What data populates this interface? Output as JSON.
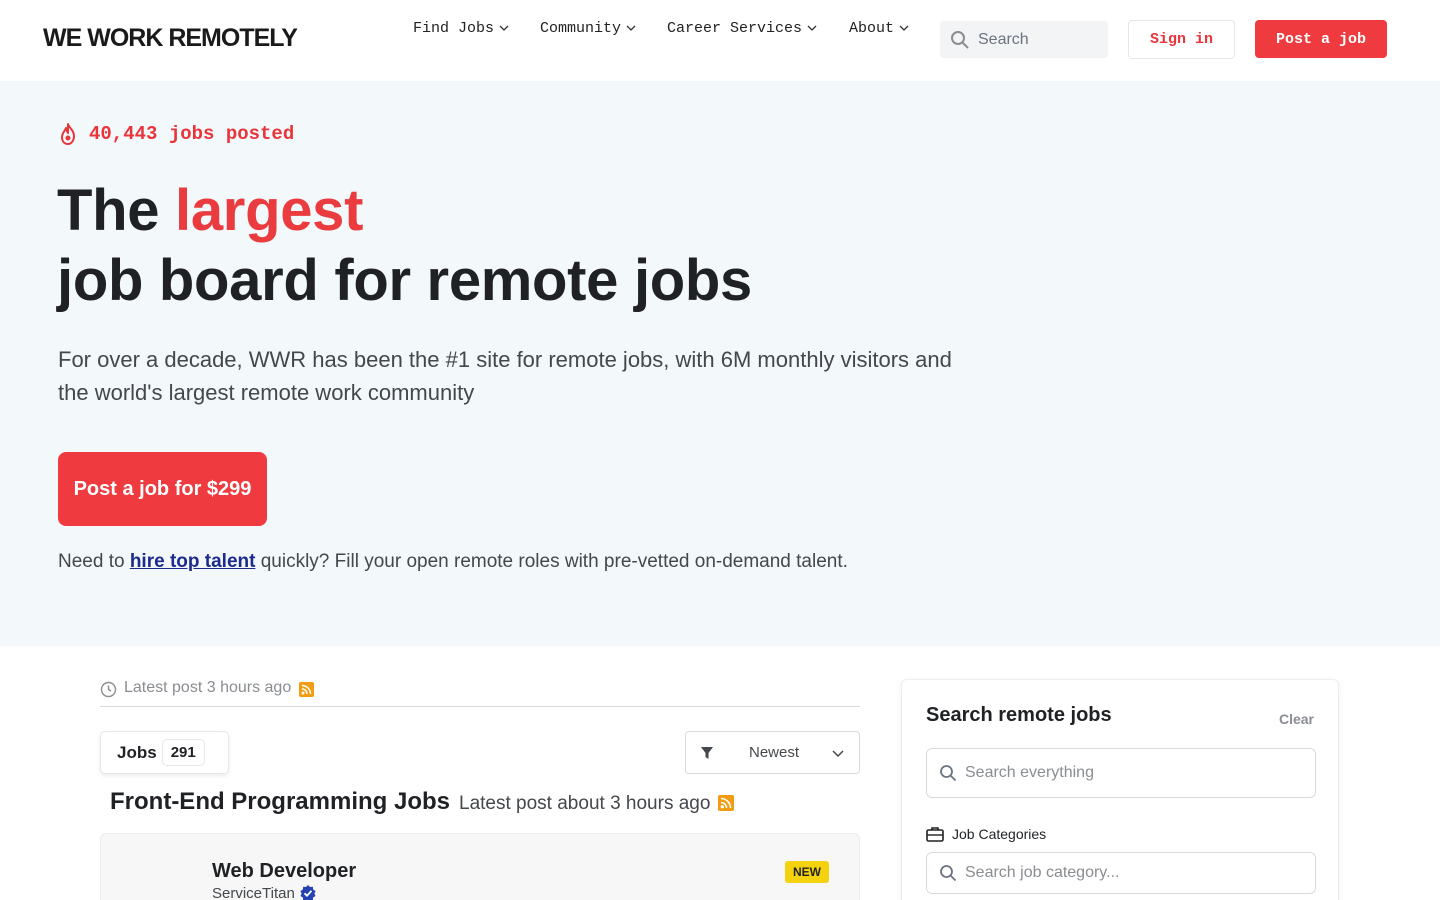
{
  "header": {
    "logo": "WE WORK REMOTELY",
    "nav": [
      {
        "label": "Find Jobs"
      },
      {
        "label": "Community"
      },
      {
        "label": "Career Services"
      },
      {
        "label": "About"
      }
    ],
    "search_placeholder": "Search",
    "signin_label": "Sign in",
    "post_job_label": "Post a job"
  },
  "hero": {
    "jobs_posted": "40,443 jobs posted",
    "headline_prefix": "The ",
    "headline_accent": "largest",
    "headline_line2": "job board for remote jobs",
    "subtext": "For over a decade, WWR has been the #1 site for remote jobs, with 6M monthly visitors and the world's largest remote work community",
    "cta_label": "Post a job for $299",
    "hire_prefix": "Need to ",
    "hire_link": "hire top talent",
    "hire_suffix": " quickly? Fill your open remote roles with pre-vetted on-demand talent."
  },
  "listing": {
    "latest_post": "Latest post 3 hours ago",
    "jobs_tab_label": "Jobs",
    "jobs_count": "291",
    "sort_label": "Newest",
    "section_title": "Front-End Programming Jobs",
    "section_meta": "Latest post about 3 hours ago",
    "jobs": [
      {
        "title": "Web Developer",
        "company": "ServiceTitan",
        "badge": "NEW"
      }
    ]
  },
  "sidebar": {
    "title": "Search remote jobs",
    "clear_label": "Clear",
    "search_placeholder": "Search everything",
    "categories_label": "Job Categories",
    "category_placeholder": "Search job category..."
  },
  "colors": {
    "brand_red": "#ef3b3f",
    "hero_bg": "#f3f8fb",
    "link_blue": "#1d2b8f",
    "badge_yellow": "#f5d20e",
    "rss_orange": "#f39c12"
  }
}
